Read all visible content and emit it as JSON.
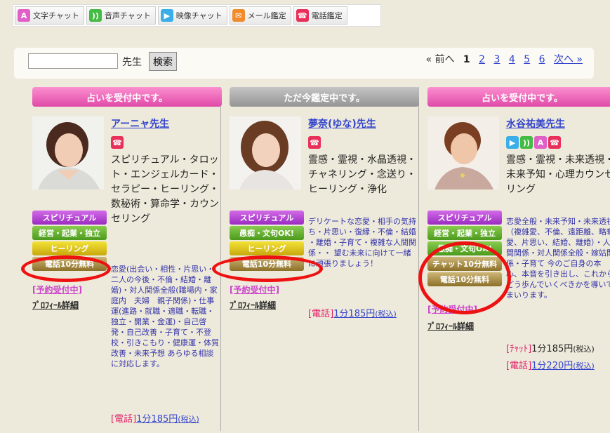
{
  "filters": [
    {
      "icon": "A",
      "label": "文字チャット",
      "color": "#e060c8"
    },
    {
      "icon": "))",
      "label": "音声チャット",
      "color": "#44bb44"
    },
    {
      "icon": "▶",
      "label": "映像チャット",
      "color": "#3aaee8"
    },
    {
      "icon": "✉",
      "label": "メール鑑定",
      "color": "#f08c2c"
    },
    {
      "icon": "☎",
      "label": "電話鑑定",
      "color": "#e8305a"
    }
  ],
  "search": {
    "label": "先生",
    "button": "検索",
    "value": ""
  },
  "pager": {
    "prev": "« 前へ",
    "current": "1",
    "pages": [
      "2",
      "3",
      "4",
      "5",
      "6"
    ],
    "next": "次へ »"
  },
  "columns": [
    {
      "status": "占いを受付中です。",
      "name": "アーニャ先生",
      "method_icons": [
        "☎"
      ],
      "categories": "スピリチュアル・タロット・エンジェルカード・セラピー・ヒーリング・数秘術・算命学・カウンセリング",
      "tags": [
        "スピリチュアル",
        "経営・起業・独立",
        "ヒーリング",
        "電話10分無料"
      ],
      "intro": "恋愛(出会い・相性・片思い・二人の今後・不倫・結婚・離婚)・対人関係全般(職場内・家庭内　夫婦　親子関係)・仕事運(進路・就職・適職・転職・独立・開業・金運)・自己啓発・自己改善・子育て・不登校・引きこもり・健康運・体質改善・未来予想 あらゆる相談に対応します。",
      "reserve": "[予約受付中]",
      "profile": "ﾌﾟﾛﾌｨｰﾙ詳細",
      "prices": [
        {
          "label": "[電話]",
          "amount": "1分185円",
          "tax": "(税込)"
        }
      ]
    },
    {
      "status": "ただ今鑑定中です。",
      "name": "夢奈(ゆな)先生",
      "method_icons": [
        "☎"
      ],
      "categories": "霊感・霊視・水晶透視・チャネリング・念送り・ヒーリング・浄化",
      "tags": [
        "スピリチュアル",
        "愚痴・文句OK!",
        "ヒーリング",
        "電話10分無料"
      ],
      "intro": "デリケートな恋愛・相手の気持ち・片思い・復縁・不倫・結婚 ・離婚・子育て・複雑な人間関係・・ 望む未来に向けて一緒に頑張りましょう！",
      "reserve": "[予約受付中]",
      "profile": "ﾌﾟﾛﾌｨｰﾙ詳細",
      "prices": [
        {
          "label": "[電話]",
          "amount": "1分185円",
          "tax": "(税込)"
        }
      ]
    },
    {
      "status": "占いを受付中です。",
      "name": "水谷祐美先生",
      "method_icons": [
        "▶",
        "))",
        "A",
        "☎"
      ],
      "categories": "霊感・霊視・未来透視・未来予知・心理カウンセリング",
      "tags": [
        "スピリチュアル",
        "経営・起業・独立",
        "愚痴・文句OK!",
        "チャット10分無料",
        "電話10分無料"
      ],
      "intro": "恋愛全般・未来予知・未来透視（複雑愛、不倫、遠距離、略奪愛、片思い、結婚、離婚）・人間関係・対人関係全般・嫁姑関係・子育て 今のご自身の本心、本音を引き出し、これからどう歩んでいくべきかを導いてまいります。",
      "reserve": "[予約受付中]",
      "profile": "ﾌﾟﾛﾌｨｰﾙ詳細",
      "prices": [
        {
          "label": "[ﾁｬｯﾄ]",
          "amount": "1分185円",
          "tax": "(税込)"
        },
        {
          "label": "[電話]",
          "amount": "1分220円",
          "tax": "(税込)"
        }
      ]
    }
  ]
}
